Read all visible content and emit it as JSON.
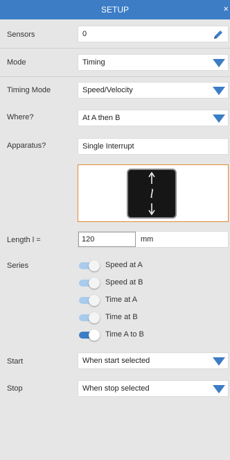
{
  "header": {
    "title": "SETUP",
    "close": "×"
  },
  "sensors": {
    "label": "Sensors",
    "value": "0"
  },
  "mode": {
    "label": "Mode",
    "value": "Timing"
  },
  "timing_mode": {
    "label": "Timing Mode",
    "value": "Speed/Velocity"
  },
  "where": {
    "label": "Where?",
    "value": "At A then B"
  },
  "apparatus": {
    "label": "Apparatus?",
    "value": "Single Interrupt",
    "symbol": "l"
  },
  "length": {
    "label": "Length l =",
    "value": "120",
    "unit": "mm"
  },
  "series": {
    "label": "Series",
    "items": [
      {
        "label": "Speed at A",
        "on": false
      },
      {
        "label": "Speed at B",
        "on": false
      },
      {
        "label": "Time at A",
        "on": false
      },
      {
        "label": "Time at B",
        "on": false
      },
      {
        "label": "Time A to B",
        "on": true
      }
    ]
  },
  "start": {
    "label": "Start",
    "value": "When start selected"
  },
  "stop": {
    "label": "Stop",
    "value": "When stop selected"
  },
  "colors": {
    "accent": "#3c7dc6",
    "highlight": "#e08a2e",
    "background": "#e6e6e6"
  },
  "icons": {
    "edit": "pencil-icon",
    "dropdown": "triangle-down-icon",
    "close": "close-icon"
  }
}
